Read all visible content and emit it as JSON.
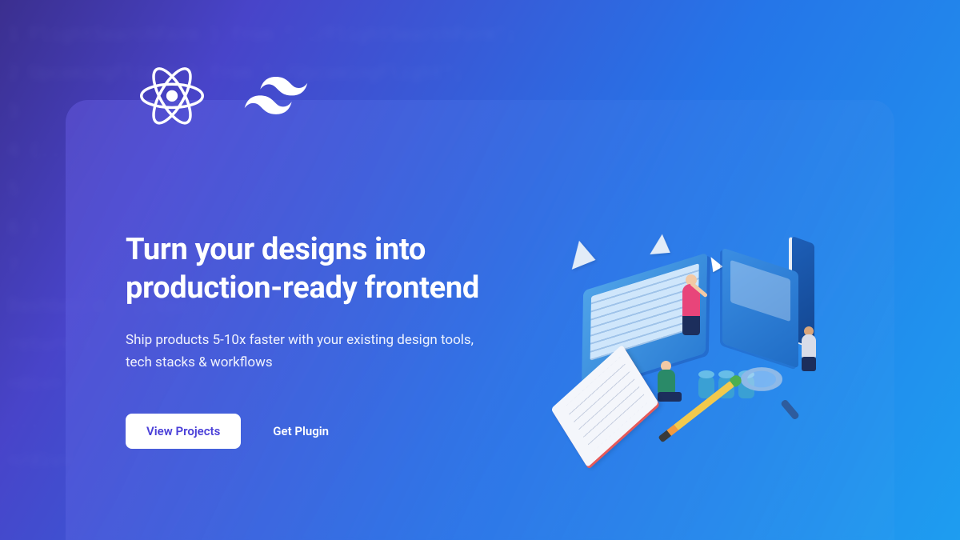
{
  "hero": {
    "headline": "Turn your designs into production-ready frontend",
    "subheadline": "Ship products 5-10x faster with your existing design tools, tech stacks & workflows",
    "primary_cta": "View Projects",
    "secondary_cta": "Get Plugin"
  },
  "logos": {
    "react": "react-icon",
    "tailwind": "tailwind-icon"
  },
  "colors": {
    "gradient_start": "#3b2f8f",
    "gradient_mid": "#4844c9",
    "gradient_end": "#1e9df0",
    "primary_button_bg": "#ffffff",
    "primary_button_text": "#4a3fd8",
    "text": "#ffffff"
  }
}
